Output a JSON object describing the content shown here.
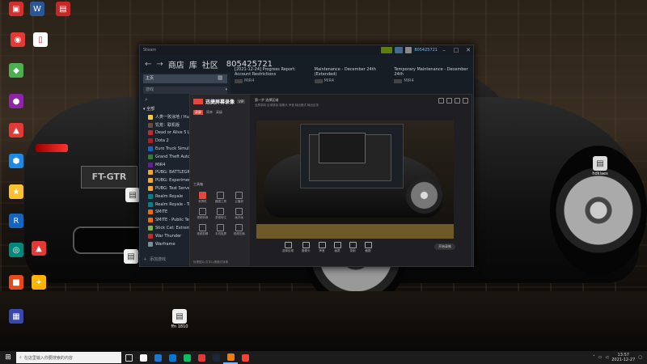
{
  "desktop": {
    "icons": [
      {
        "id": "d1",
        "label": "",
        "color": "#d32f2f",
        "glyph": "▣"
      },
      {
        "id": "d2",
        "label": "",
        "color": "#2b5797",
        "glyph": "W"
      },
      {
        "id": "d3",
        "label": "",
        "color": "#c62828",
        "glyph": "▤"
      },
      {
        "id": "d4",
        "label": "",
        "color": "#e53935",
        "glyph": "◉"
      },
      {
        "id": "d5",
        "label": "",
        "color": "#ffffff",
        "glyph": "▯"
      },
      {
        "id": "d6",
        "label": "",
        "color": "#4caf50",
        "glyph": "◆"
      },
      {
        "id": "d7",
        "label": "",
        "color": "#8e24aa",
        "glyph": "●"
      },
      {
        "id": "d8",
        "label": "",
        "color": "#e53935",
        "glyph": "▲"
      },
      {
        "id": "d9",
        "label": "",
        "color": "#1e88e5",
        "glyph": "⬢"
      },
      {
        "id": "d10",
        "label": "",
        "color": "#fbc02d",
        "glyph": "★"
      },
      {
        "id": "d11",
        "label": "",
        "color": "#1565c0",
        "glyph": "R"
      },
      {
        "id": "d12",
        "label": "",
        "color": "#00897b",
        "glyph": "◎"
      },
      {
        "id": "d13",
        "label": "",
        "color": "#e53935",
        "glyph": "▲"
      },
      {
        "id": "d14",
        "label": "",
        "color": "#e64a19",
        "glyph": "■"
      },
      {
        "id": "d15",
        "label": "",
        "color": "#ffb300",
        "glyph": "✦"
      },
      {
        "id": "d16",
        "label": "",
        "color": "#3949ab",
        "glyph": "▦"
      }
    ],
    "files": {
      "mid": "ffn 1810",
      "doc": "",
      "doc2": "",
      "right": "hdklaes"
    }
  },
  "steam": {
    "menu": [
      "Steam"
    ],
    "user": "805425721",
    "nav": {
      "back": "←",
      "forward": "→",
      "store": "商店",
      "library": "库",
      "community": "社区",
      "id": "805425721"
    },
    "library": {
      "home": "主页",
      "filter": "游戏",
      "all_label": "全部",
      "games": [
        {
          "name": "人类一败涂地 / Hu",
          "color": "#f5c842"
        },
        {
          "name": "饥荒：联机版",
          "color": "#6d4c41"
        },
        {
          "name": "Dead or Alive 5 La",
          "color": "#c62828"
        },
        {
          "name": "Dota 2",
          "color": "#b71c1c"
        },
        {
          "name": "Euro Truck Simula",
          "color": "#1565c0"
        },
        {
          "name": "Grand Theft Auto",
          "color": "#2e7d32"
        },
        {
          "name": "MIR4",
          "color": "#6a1b9a"
        },
        {
          "name": "PUBG: BATTLEGR",
          "color": "#f9a825"
        },
        {
          "name": "PUBG: Experimen",
          "color": "#f9a825"
        },
        {
          "name": "PUBG: Test Server",
          "color": "#f9a825"
        },
        {
          "name": "Realm Royale",
          "color": "#00838f"
        },
        {
          "name": "Realm Royale - Te",
          "color": "#00838f"
        },
        {
          "name": "SMITE",
          "color": "#ef6c00"
        },
        {
          "name": "SMITE - Public Tes",
          "color": "#ef6c00"
        },
        {
          "name": "Stick Cat: Extreme",
          "color": "#7cb342"
        },
        {
          "name": "War Thunder",
          "color": "#c62828"
        },
        {
          "name": "Warframe",
          "color": "#78909c"
        }
      ],
      "add": "添加游戏"
    },
    "news": [
      {
        "title": "[2021-12-24] Progress Report: Account Restrictions",
        "src": "MIR4"
      },
      {
        "title": "Maintenance - December 24th (Extended)",
        "src": "MIR4"
      },
      {
        "title": "Temporary Maintenance - December 24th",
        "src": "MIR4"
      }
    ]
  },
  "capture": {
    "app_name": "迅捷屏幕录像",
    "version": "VIP",
    "tabs": [
      "录屏",
      "简单",
      "高级"
    ],
    "tools_title": "工具箱",
    "tools": [
      "录屏机",
      "截图工具",
      "云播放",
      "视频转换",
      "录音转文",
      "画中画",
      "视频剪辑",
      "手机投屏",
      "视频压缩"
    ],
    "footer": "处理图片/文字以便格式转换",
    "title": "第一步 选择区域",
    "sub": "全屏录制 区域录制 摄像头 声音 输出格式 输出目录",
    "bottom": [
      "选择区域",
      "摄像头",
      "声音",
      "画质",
      "录制",
      "截图"
    ],
    "start": "开始录制"
  },
  "taskbar": {
    "search_placeholder": "在这里输入你要搜索的内容",
    "time": "13:57",
    "date": "2021-12-27",
    "apps": [
      {
        "color": "#ffffff"
      },
      {
        "color": "#1976d2"
      },
      {
        "color": "#0078d7"
      },
      {
        "color": "#07c160"
      },
      {
        "color": "#e53935"
      },
      {
        "color": "#1b2838"
      },
      {
        "color": "#f57c00"
      },
      {
        "color": "#f44336"
      }
    ]
  }
}
